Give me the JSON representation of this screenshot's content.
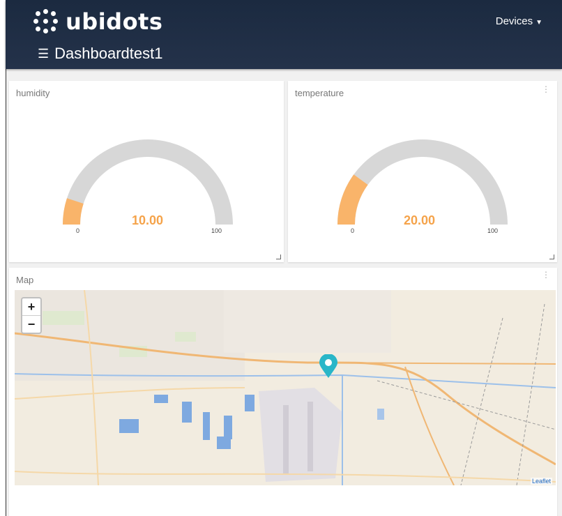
{
  "header": {
    "brand": "ubidots",
    "devices_label": "Devices",
    "dashboard_title": "Dashboardtest1"
  },
  "widgets": {
    "humidity": {
      "title": "humidity",
      "value": "10.00",
      "min": "0",
      "max": "100",
      "fraction": 0.1
    },
    "temperature": {
      "title": "temperature",
      "value": "20.00",
      "min": "0",
      "max": "100",
      "fraction": 0.2
    },
    "map": {
      "title": "Map",
      "zoom_in": "+",
      "zoom_out": "−",
      "attribution": "Leaflet"
    }
  },
  "colors": {
    "header_bg": "#1b2a40",
    "gauge_fill": "#f9b46a",
    "gauge_track": "#d7d7d7",
    "value_text": "#f5a34a",
    "marker": "#29b6c8"
  }
}
